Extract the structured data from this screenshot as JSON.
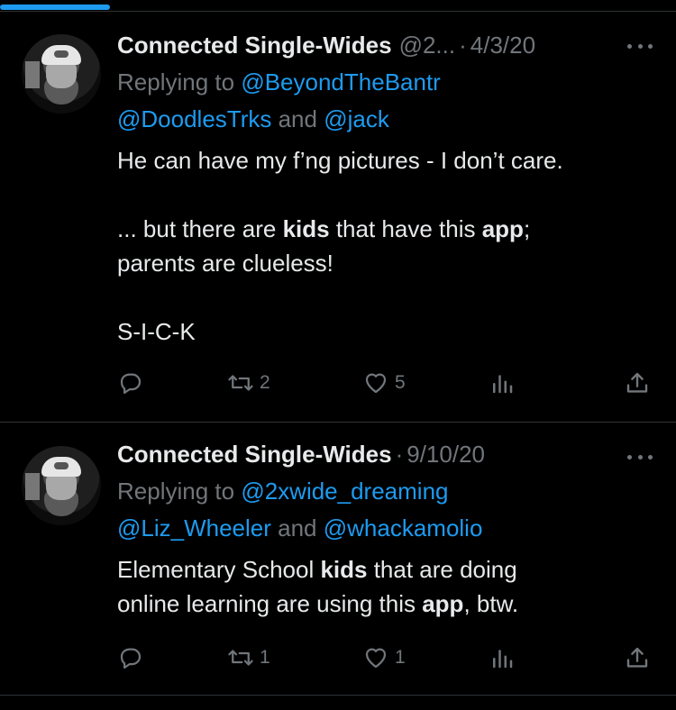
{
  "colors": {
    "background": "#000000",
    "text": "#e7e9ea",
    "muted": "#71767b",
    "accent": "#1d9bf0",
    "divider": "#2f3336"
  },
  "tweets": [
    {
      "name": "Connected Single-Wides",
      "handle": "@2...",
      "date": "4/3/20",
      "replying_prefix": "Replying to ",
      "reply_to_1": "@BeyondTheBantr",
      "reply_to_2": "@DoodlesTrks",
      "reply_and": " and ",
      "reply_to_3": "@jack",
      "line1": "He can have my f’ng pictures - I don’t care.",
      "line2_a": "... but there are ",
      "line2_b": "kids",
      "line2_c": " that have this ",
      "line2_d": "app",
      "line2_e": ";",
      "line3": "parents are clueless!",
      "line4": "S-I-C-K",
      "retweets": "2",
      "likes": "5"
    },
    {
      "name": "Connected Single-Wides",
      "date": "9/10/20",
      "replying_prefix": "Replying to ",
      "reply_to_1": "@2xwide_dreaming",
      "reply_to_2": "@Liz_Wheeler",
      "reply_and": " and ",
      "reply_to_3": "@whackamolio",
      "line1_a": "Elementary School ",
      "line1_b": "kids",
      "line1_c": " that are doing",
      "line2_a": "online learning are using this ",
      "line2_b": "app",
      "line2_c": ", btw.",
      "retweets": "1",
      "likes": "1"
    }
  ],
  "icons": [
    "more-icon",
    "reply-icon",
    "retweet-icon",
    "like-icon",
    "views-icon",
    "share-icon"
  ]
}
